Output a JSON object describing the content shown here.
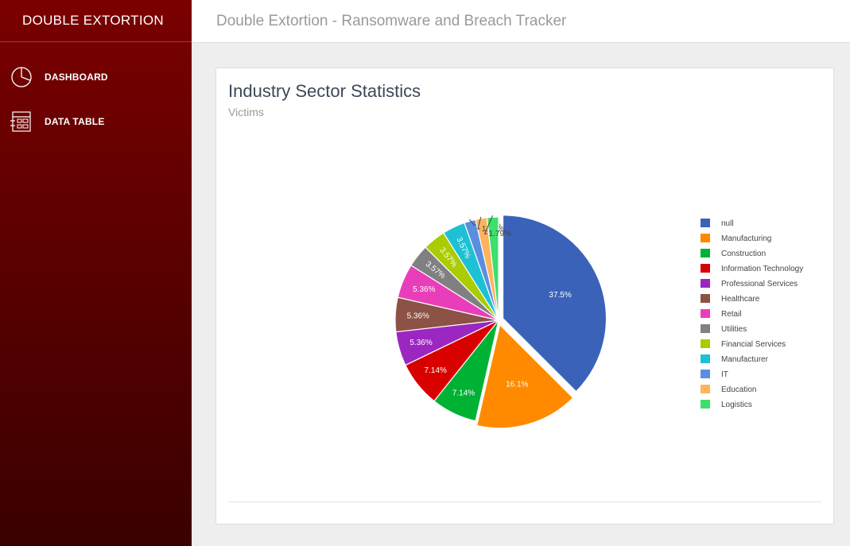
{
  "sidebar": {
    "brand": "DOUBLE EXTORTION",
    "items": [
      {
        "label": "DASHBOARD",
        "icon": "pie-chart-icon"
      },
      {
        "label": "DATA TABLE",
        "icon": "data-table-icon"
      }
    ]
  },
  "header": {
    "title": "Double Extortion - Ransomware and Breach Tracker"
  },
  "card": {
    "title": "Industry Sector Statistics",
    "subtitle": "Victims"
  },
  "chart_data": {
    "type": "pie",
    "title": "Industry Sector Statistics",
    "subtitle": "Victims",
    "legend_position": "right",
    "slices": [
      {
        "label": "null",
        "value": 37.5,
        "text": "37.5%",
        "color": "#3a62b9"
      },
      {
        "label": "Manufacturing",
        "value": 16.1,
        "text": "16.1%",
        "color": "#ff8a00"
      },
      {
        "label": "Construction",
        "value": 7.14,
        "text": "7.14%",
        "color": "#00b234"
      },
      {
        "label": "Information Technology",
        "value": 7.14,
        "text": "7.14%",
        "color": "#d90000"
      },
      {
        "label": "Professional Services",
        "value": 5.36,
        "text": "5.36%",
        "color": "#9c27c0"
      },
      {
        "label": "Healthcare",
        "value": 5.36,
        "text": "5.36%",
        "color": "#8b5245"
      },
      {
        "label": "Retail",
        "value": 5.36,
        "text": "5.36%",
        "color": "#e83eba"
      },
      {
        "label": "Utilities",
        "value": 3.57,
        "text": "3.57%",
        "color": "#808080"
      },
      {
        "label": "Financial Services",
        "value": 3.57,
        "text": "3.57%",
        "color": "#aacc00"
      },
      {
        "label": "Manufacturer",
        "value": 3.57,
        "text": "3.57%",
        "color": "#1ec0d4"
      },
      {
        "label": "IT",
        "value": 1.79,
        "text": "1.79%",
        "color": "#5b8ee0"
      },
      {
        "label": "Education",
        "value": 1.79,
        "text": "1.79%",
        "color": "#ffb35c"
      },
      {
        "label": "Logistics",
        "value": 1.79,
        "text": "1.79%",
        "color": "#3de06a"
      }
    ]
  }
}
